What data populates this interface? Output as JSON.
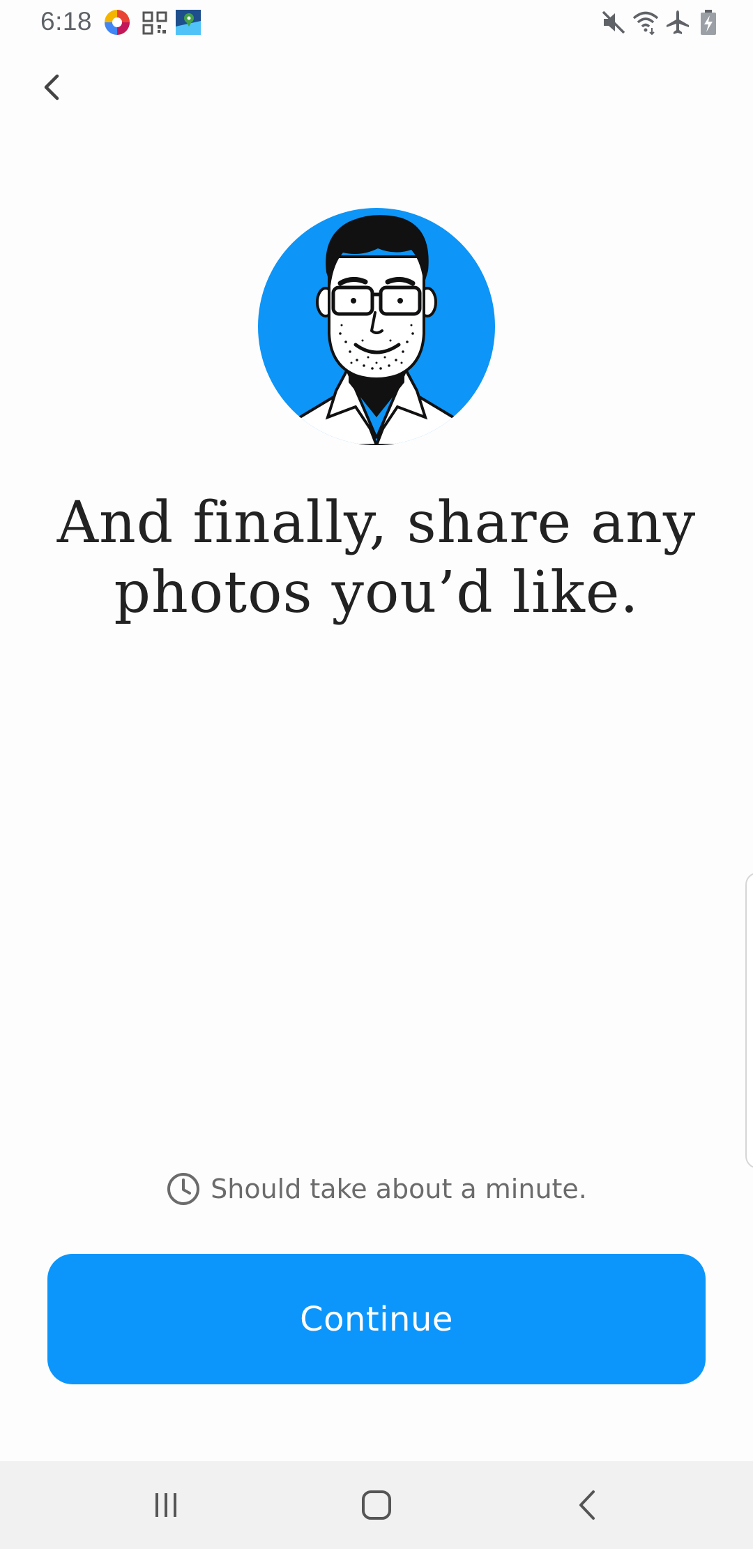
{
  "status_bar": {
    "time": "6:18",
    "notification_icons": [
      "photos-app-icon",
      "qr-code-icon",
      "maps-app-icon"
    ],
    "system_icons": [
      "mute-icon",
      "wifi-icon",
      "airplane-mode-icon",
      "battery-charging-icon"
    ]
  },
  "header": {
    "back_icon": "chevron-left-icon"
  },
  "main": {
    "illustration": "avatar-illustration",
    "heading_line1": "And finally, share any",
    "heading_line2": "photos you’d like.",
    "duration_icon": "clock-icon",
    "duration_text": "Should take about a minute.",
    "continue_label": "Continue"
  },
  "nav_bar": {
    "items": [
      "recent-apps-icon",
      "home-icon",
      "back-icon"
    ]
  },
  "colors": {
    "accent": "#0c96fb",
    "heading": "#222222",
    "muted": "#6b6b6b",
    "nav_background": "#f1f1f1"
  }
}
